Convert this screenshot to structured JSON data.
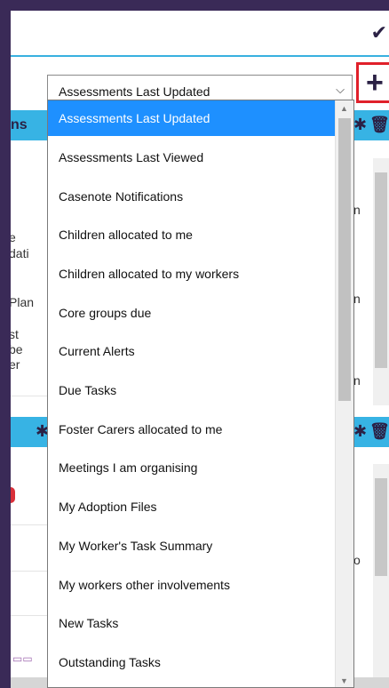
{
  "select": {
    "value": "Assessments Last Updated",
    "options": [
      "Assessments Last Updated",
      "Assessments Last Viewed",
      "Casenote Notifications",
      "Children allocated to me",
      "Children allocated to my workers",
      "Core groups due",
      "Current Alerts",
      "Due Tasks",
      "Foster Carers allocated to me",
      "Meetings I am organising",
      "My Adoption Files",
      "My Worker's Task Summary",
      "My workers other involvements",
      "New Tasks",
      "Outstanding Tasks"
    ]
  },
  "background": {
    "widget1_title_fragment": "ns",
    "text_fragments": [
      "e",
      "dati",
      "Plan",
      "st",
      "be",
      "er"
    ],
    "right_fragments": [
      "n",
      "n",
      "n",
      "o"
    ]
  },
  "icons": {
    "check": "check-icon",
    "add": "plus-icon",
    "gear": "gear-icon",
    "trash": "trash-icon",
    "caret": "chevron-down-icon"
  },
  "colors": {
    "accent": "#37b3e4",
    "selected": "#1e90ff",
    "frame": "#3a2a57",
    "add_border": "#e0202a"
  }
}
